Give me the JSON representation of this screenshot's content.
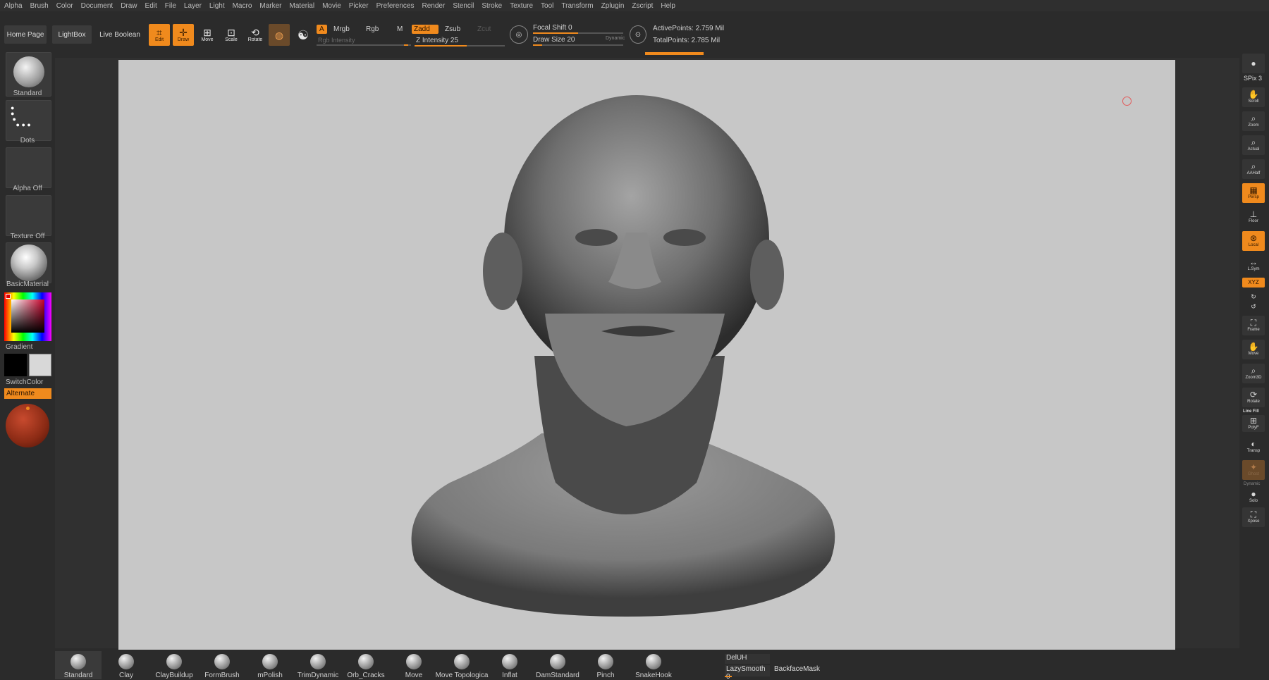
{
  "menu": [
    "Alpha",
    "Brush",
    "Color",
    "Document",
    "Draw",
    "Edit",
    "File",
    "Layer",
    "Light",
    "Macro",
    "Marker",
    "Material",
    "Movie",
    "Picker",
    "Preferences",
    "Render",
    "Stencil",
    "Stroke",
    "Texture",
    "Tool",
    "Transform",
    "Zplugin",
    "Zscript",
    "Help"
  ],
  "toolbar": {
    "home": "Home Page",
    "lightbox": "LightBox",
    "live_boolean": "Live Boolean",
    "edit": "Edit",
    "draw": "Draw",
    "move": "Move",
    "scale": "Scale",
    "rotate": "Rotate",
    "a": "A",
    "mrgb": "Mrgb",
    "rgb": "Rgb",
    "m": "M",
    "rgb_intensity": "Rgb Intensity",
    "zadd": "Zadd",
    "zsub": "Zsub",
    "zcut": "Zcut",
    "z_intensity": "Z Intensity 25",
    "focal_shift": "Focal Shift 0",
    "draw_size": "Draw Size 20",
    "dynamic": "Dynamic",
    "active_points": "ActivePoints: 2.759 Mil",
    "total_points": "TotalPoints: 2.785 Mil",
    "z_intensity_value": 25,
    "draw_size_value": 20,
    "focal_shift_value": 0
  },
  "left": {
    "brush": "Standard",
    "stroke": "Dots",
    "alpha": "Alpha Off",
    "texture": "Texture Off",
    "material": "BasicMaterial",
    "gradient": "Gradient",
    "switch_color": "SwitchColor",
    "alternate": "Alternate"
  },
  "right": {
    "spix": "SPix 3",
    "buttons": [
      "Scroll",
      "Zoom",
      "Actual",
      "AAHalf",
      "Persp",
      "Floor",
      "Local",
      "L.Sym",
      "XYZ",
      "Frame",
      "Move",
      "Zoom3D",
      "Rotate",
      "PolyF",
      "Transp",
      "Ghost",
      "Solo",
      "Xpose"
    ],
    "line_fill": "Line Fill",
    "dynamic_label": "Dynamic"
  },
  "bottom": {
    "brushes": [
      "Standard",
      "Clay",
      "ClayBuildup",
      "FormBrush",
      "mPolish",
      "TrimDynamic",
      "Orb_Cracks",
      "Move",
      "Move Topologica",
      "Inflat",
      "DamStandard",
      "Pinch",
      "SnakeHook"
    ],
    "deluh": "DelUH",
    "lazy_smooth": "LazySmooth 0",
    "backface_mask": "BackfaceMask"
  },
  "colors": {
    "accent": "#f08a1d",
    "viewport_bg": "#c7c7c7",
    "ui_bg": "#2b2b2b"
  }
}
